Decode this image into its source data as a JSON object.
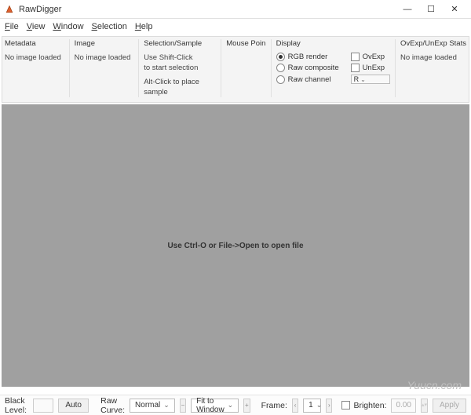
{
  "title": "RawDigger",
  "menu": {
    "file": "File",
    "view": "View",
    "window": "Window",
    "selection": "Selection",
    "help": "Help"
  },
  "panels": {
    "metadata": {
      "header": "Metadata",
      "body": "No image loaded"
    },
    "image": {
      "header": "Image",
      "body": "No image loaded"
    },
    "selection": {
      "header": "Selection/Sample",
      "line1": "Use Shift-Click",
      "line2": "to start selection",
      "line3": "Alt-Click to place",
      "line4": "sample"
    },
    "mouse": {
      "header": "Mouse Poin"
    },
    "display": {
      "header": "Display",
      "rgb_render": "RGB render",
      "raw_composite": "Raw composite",
      "raw_channel": "Raw channel",
      "channel_sel": "R",
      "ovexp": "OvExp",
      "unexp": "UnExp"
    },
    "stats": {
      "header": "OvExp/UnExp Stats",
      "body": "No image loaded"
    }
  },
  "canvas_hint": "Use Ctrl-O or File->Open to open file",
  "status": {
    "black_level_label": "Black Level:",
    "auto": "Auto",
    "raw_curve_label": "Raw Curve:",
    "raw_curve_value": "Normal",
    "zoom": "Fit to Window",
    "frame_label": "Frame:",
    "frame_value": "1",
    "brighten_label": "Brighten:",
    "brighten_value": "0.00",
    "apply": "Apply"
  },
  "watermark": "Yuucn.com"
}
